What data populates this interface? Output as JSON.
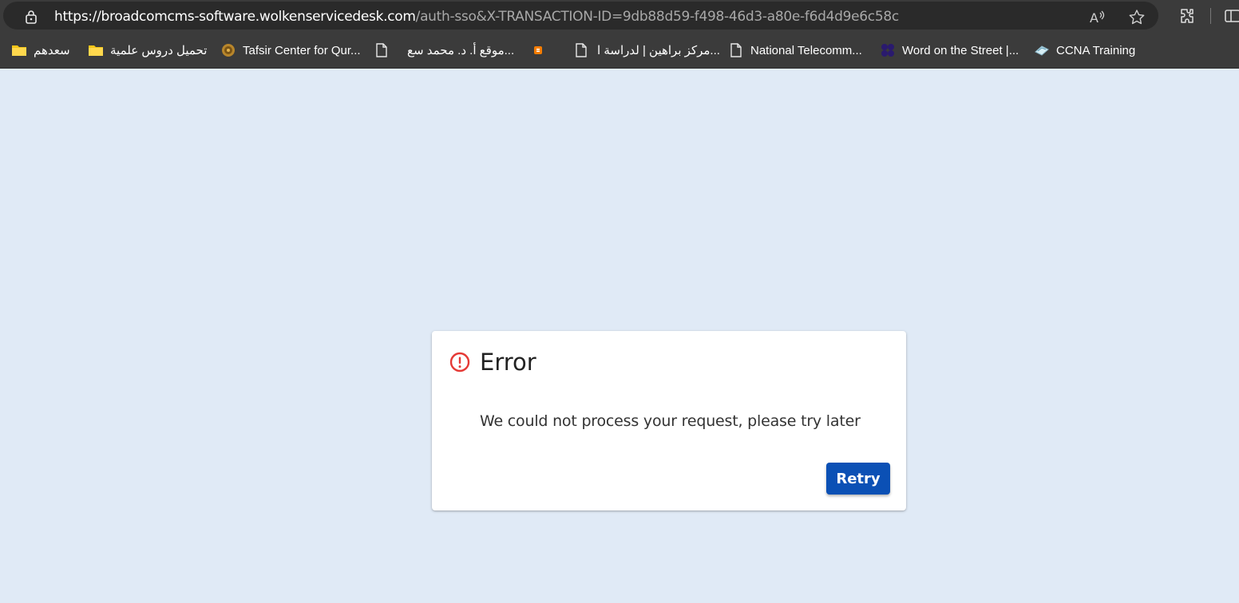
{
  "browser": {
    "url_host": "https://broadcomcms-software.wolkenservicedesk.com",
    "url_path": "/auth-sso&X-TRANSACTION-ID=9db88d59-f498-46d3-a80e-f6d4d9e6c58c",
    "icons": [
      "lock-icon",
      "read-aloud-icon",
      "star-icon",
      "extensions-icon",
      "split-screen-icon"
    ]
  },
  "bookmarks": [
    {
      "label": "سعدهم",
      "icon": "folder-icon"
    },
    {
      "label": "تحميل دروس علمية",
      "icon": "folder-icon"
    },
    {
      "label": "Tafsir Center for Qur...",
      "icon": "site-logo-icon"
    },
    {
      "label": "موقع أ. د. محمد سع...",
      "icon": "page-icon"
    },
    {
      "label": "",
      "icon": "blogger-icon"
    },
    {
      "label": "مركز براهين | لدراسة ا...",
      "icon": "page-icon"
    },
    {
      "label": "National Telecomm...",
      "icon": "page-icon"
    },
    {
      "label": "Word on the Street |...",
      "icon": "dots-logo-icon"
    },
    {
      "label": "CCNA Training",
      "icon": "ccna-icon"
    }
  ],
  "error_card": {
    "title": "Error",
    "message": "We could not process your request, please try later",
    "retry_label": "Retry"
  },
  "colors": {
    "page_bg": "#e0eaf6",
    "error_icon": "#e53935",
    "retry_button": "#0b50b5",
    "chrome_bg": "#3b3b3b"
  }
}
